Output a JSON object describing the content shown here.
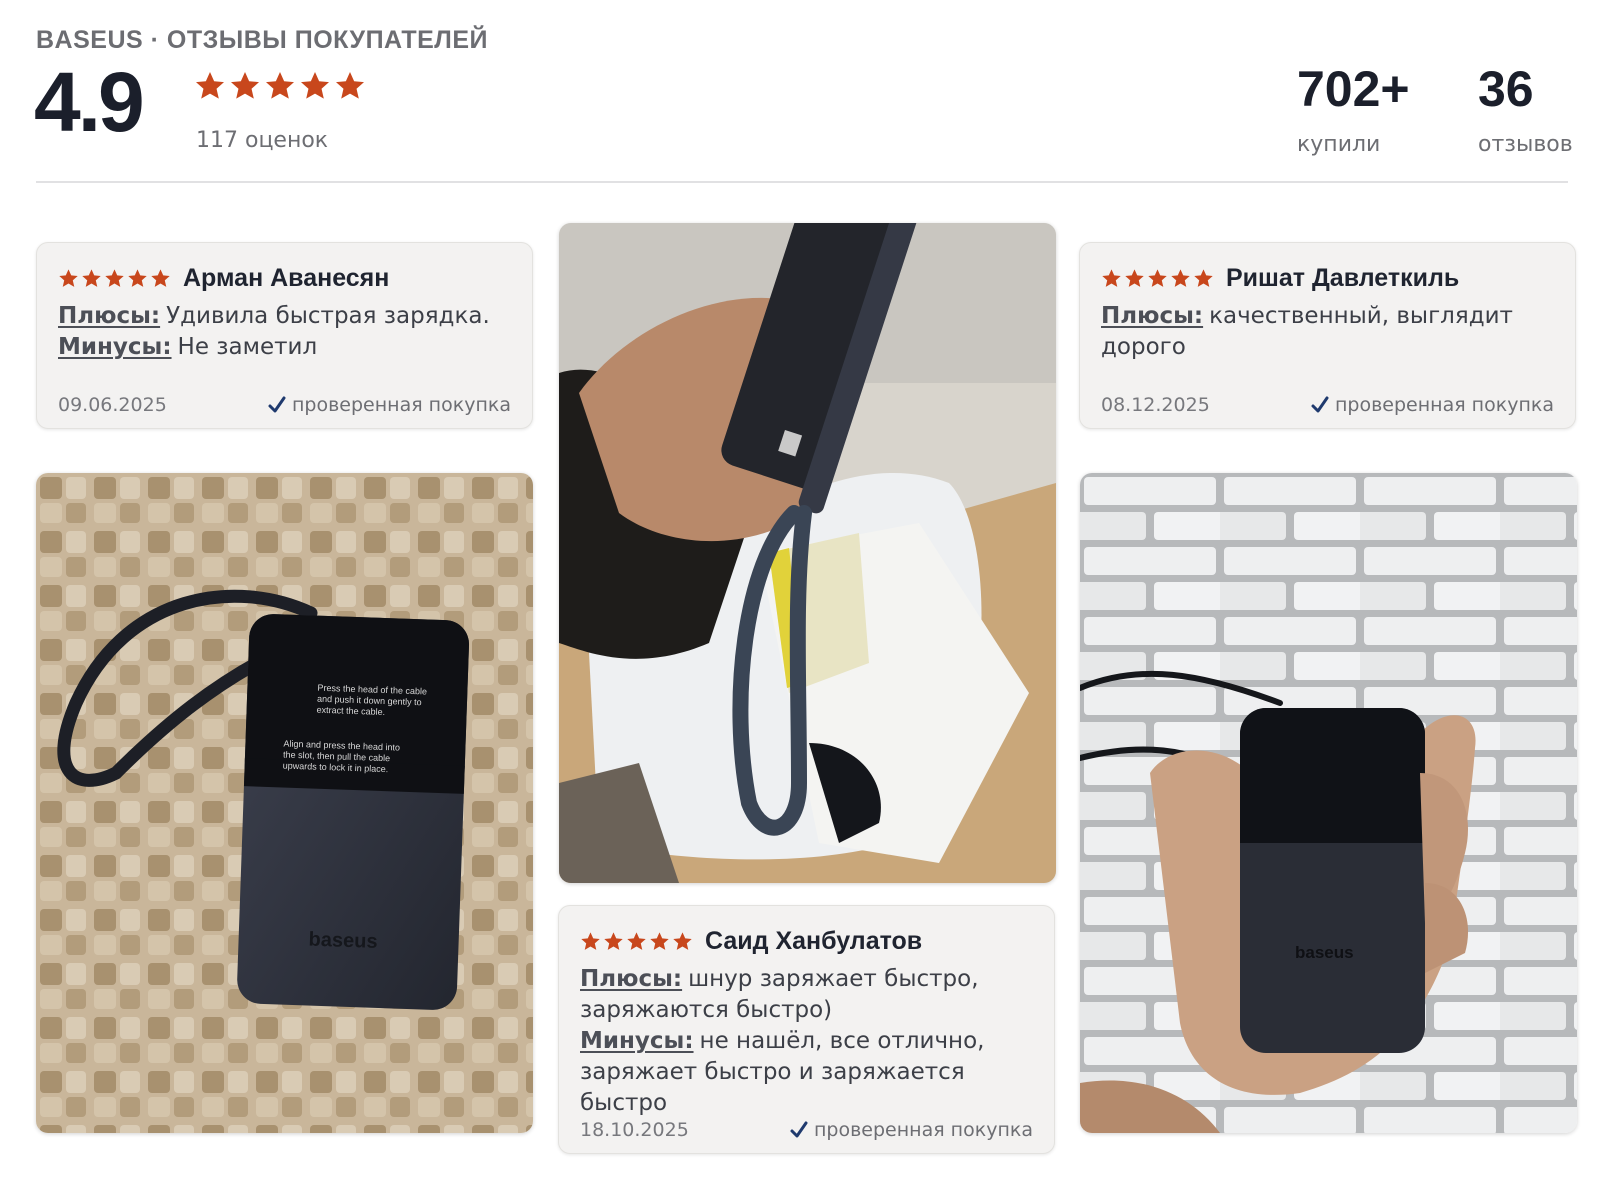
{
  "header": {
    "brand_line": "BASEUS · ОТЗЫВЫ ПОКУПАТЕЛЕЙ",
    "rating": "4.9",
    "ratings_count": "117 оценок",
    "stars": 5,
    "bought_value": "702+",
    "bought_label": "купили",
    "reviews_value": "36",
    "reviews_label": "отзывов"
  },
  "colors": {
    "star": "#c8471c",
    "check": "#1f3a6e",
    "card_bg": "#f3f2f1"
  },
  "reviews": [
    {
      "stars": 5,
      "name": "Арман Аванесян",
      "plus_label": "Плюсы:",
      "plus_text": "Удивила быстрая зарядка.",
      "minus_label": "Минусы:",
      "minus_text": "Не заметил",
      "date": "09.06.2025",
      "verified": "проверенная покупка"
    },
    {
      "stars": 5,
      "name": "Ришат Давлеткиль",
      "plus_label": "Плюсы:",
      "plus_text": "качественный, выглядит дорого",
      "date": "08.12.2025",
      "verified": "проверенная покупка"
    },
    {
      "stars": 5,
      "name": "Саид Ханбулатов",
      "plus_label": "Плюсы:",
      "plus_text": "шнур заряжает быстро, заряжаются быстро)",
      "minus_label": "Минусы:",
      "minus_text": "не нашёл, все отлично, заряжает быстро и заряжается быстро",
      "date": "18.10.2025",
      "verified": "проверенная покупка"
    }
  ],
  "photos": {
    "photo1": {
      "icon": "powerbank-photo",
      "product_logo": "baseus",
      "label_lines": [
        "Press the head of the cable",
        "and push it down gently to",
        "extract the cable.",
        "Align and press the head into",
        "the slot, then pull the cable",
        "upwards to lock it in place."
      ]
    },
    "photo2": {
      "icon": "powerbank-in-hand-photo"
    },
    "photo3": {
      "icon": "powerbank-brick-wall-photo",
      "product_logo": "baseus"
    }
  }
}
